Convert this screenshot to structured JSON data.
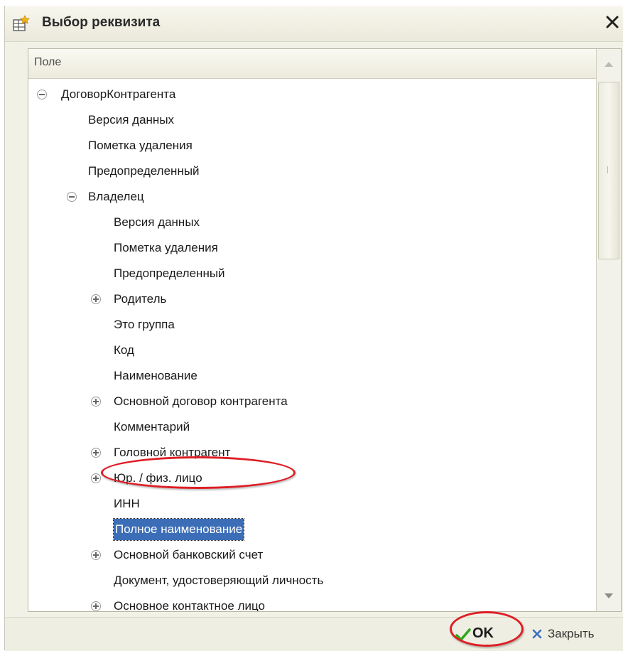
{
  "window": {
    "title": "Выбор реквизита",
    "icon": "table-plus-icon",
    "close_icon": "close-x-icon"
  },
  "table": {
    "column_header": "Поле",
    "rows": [
      {
        "label": "ДоговорКонтрагента",
        "level": 0,
        "toggle": "minus"
      },
      {
        "label": "Версия данных",
        "level": 1,
        "toggle": "none"
      },
      {
        "label": "Пометка удаления",
        "level": 1,
        "toggle": "none"
      },
      {
        "label": "Предопределенный",
        "level": 1,
        "toggle": "none"
      },
      {
        "label": "Владелец",
        "level": 1,
        "toggle": "minus"
      },
      {
        "label": "Версия данных",
        "level": 2,
        "toggle": "none"
      },
      {
        "label": "Пометка удаления",
        "level": 2,
        "toggle": "none"
      },
      {
        "label": "Предопределенный",
        "level": 2,
        "toggle": "none"
      },
      {
        "label": "Родитель",
        "level": 2,
        "toggle": "plus"
      },
      {
        "label": "Это группа",
        "level": 2,
        "toggle": "none"
      },
      {
        "label": "Код",
        "level": 2,
        "toggle": "none"
      },
      {
        "label": "Наименование",
        "level": 2,
        "toggle": "none"
      },
      {
        "label": "Основной договор контрагента",
        "level": 2,
        "toggle": "plus"
      },
      {
        "label": "Комментарий",
        "level": 2,
        "toggle": "none"
      },
      {
        "label": "Головной контрагент",
        "level": 2,
        "toggle": "plus"
      },
      {
        "label": "Юр. / физ. лицо",
        "level": 2,
        "toggle": "plus"
      },
      {
        "label": "ИНН",
        "level": 2,
        "toggle": "none"
      },
      {
        "label": "Полное наименование",
        "level": 2,
        "toggle": "none",
        "selected": true
      },
      {
        "label": "Основной банковский счет",
        "level": 2,
        "toggle": "plus"
      },
      {
        "label": "Документ, удостоверяющий личность",
        "level": 2,
        "toggle": "none"
      },
      {
        "label": "Основное контактное лицо",
        "level": 2,
        "toggle": "plus"
      }
    ]
  },
  "buttons": {
    "ok_label": "OK",
    "close_label": "Закрыть"
  },
  "colors": {
    "selection": "#3c6eb8",
    "annotation": "#dd1f26",
    "ok_check": "#2fa81c",
    "close_x": "#3a6fc0"
  }
}
